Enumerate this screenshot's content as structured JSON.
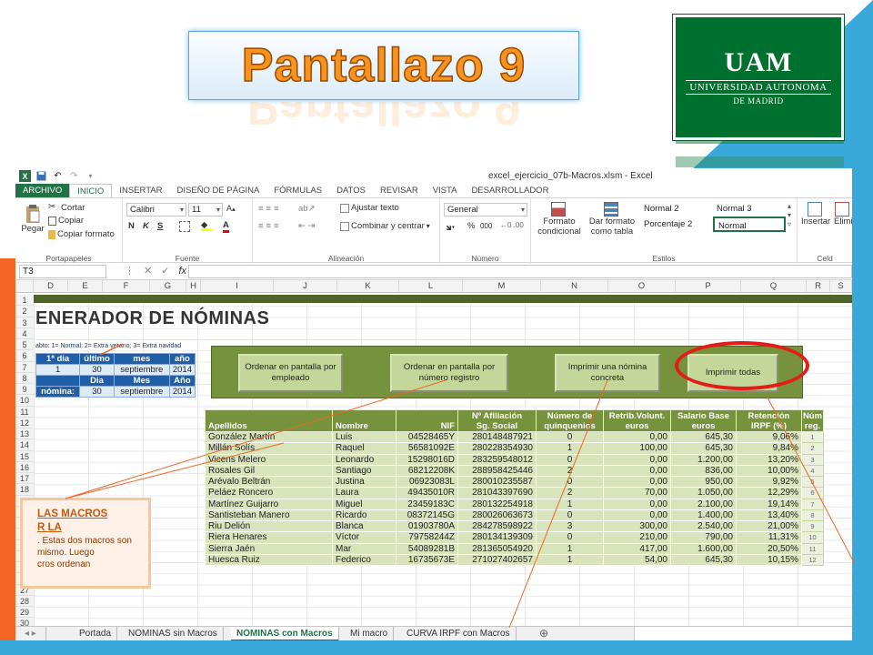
{
  "slide": {
    "title": "Pantallazo 9",
    "logo": {
      "mark": "UAM",
      "line1": "UNIVERSIDAD AUTONOMA",
      "line2": "DE MADRID"
    }
  },
  "window": {
    "title": "excel_ejercicio_07b-Macros.xlsm - Excel"
  },
  "tabs": [
    {
      "label": "ARCHIVO"
    },
    {
      "label": "INICIO"
    },
    {
      "label": "INSERTAR"
    },
    {
      "label": "DISEÑO DE PÁGINA"
    },
    {
      "label": "FÓRMULAS"
    },
    {
      "label": "DATOS"
    },
    {
      "label": "REVISAR"
    },
    {
      "label": "VISTA"
    },
    {
      "label": "DESARROLLADOR"
    }
  ],
  "ribbon": {
    "clipboard": {
      "paste": "Pegar",
      "cut": "Cortar",
      "copy": "Copiar",
      "format_painter": "Copiar formato",
      "label": "Portapapeles"
    },
    "font": {
      "name": "Calibri",
      "size": "11",
      "bold": "N",
      "italic": "K",
      "underline": "S",
      "label": "Fuente"
    },
    "alignment": {
      "wrap": "Ajustar texto",
      "merge": "Combinar y centrar",
      "label": "Alineación"
    },
    "number": {
      "format": "General",
      "percent": "%",
      "thousands": "000",
      "label": "Número"
    },
    "styles": {
      "conditional": "Formato condicional",
      "table": "Dar formato como tabla",
      "normal2": "Normal 2",
      "normal3": "Normal 3",
      "percent2": "Porcentaje 2",
      "normal": "Normal",
      "label": "Estilos"
    },
    "cells": {
      "insert": "Insertar",
      "delete": "Elimi",
      "label": "Celd"
    }
  },
  "formula_bar": {
    "name_box": "T3",
    "fx": "fx",
    "value": ""
  },
  "columns": [
    "D",
    "E",
    "F",
    "G",
    "H",
    "I",
    "J",
    "K",
    "L",
    "M",
    "N",
    "O",
    "P",
    "Q",
    "R",
    "S"
  ],
  "rows": [
    "1",
    "2",
    "3",
    "4",
    "5",
    "6",
    "7",
    "8",
    "9",
    "10",
    "11",
    "12",
    "13",
    "14",
    "15",
    "16",
    "17",
    "18",
    "19",
    "20",
    "21",
    "22",
    "23",
    "24",
    "25",
    "26",
    "27",
    "28",
    "29",
    "30"
  ],
  "sheet": {
    "heading": "ENERADOR DE NÓMINAS",
    "note": "abto: 1= Normal; 2= Extra verano; 3= Extra navidad",
    "date_box": {
      "header1": [
        "1ª dia",
        "último",
        "mes",
        "año"
      ],
      "row1": [
        "1",
        "30",
        "septiembre",
        "2014"
      ],
      "header2": [
        "",
        "Dia",
        "Mes",
        "Año"
      ],
      "row2": [
        "nómina:",
        "30",
        "septiembre",
        "2014"
      ]
    },
    "buttons": [
      {
        "label": "Ordenar en pantalla por empleado"
      },
      {
        "label": "Ordenar en pantalla por número registro"
      },
      {
        "label": "Imprimir una nómina concreta"
      },
      {
        "label": "Imprimir todas"
      }
    ],
    "table": {
      "group_headers": [
        "Nº Afiliación",
        "Número de",
        "Retrib.Volunt.",
        "Salario Base",
        "Retención",
        "Núm"
      ],
      "headers": [
        "Apellidos",
        "Nombre",
        "NIF",
        "Sg. Social",
        "quinquenios",
        "euros",
        "euros",
        "IRPF (%)",
        "reg."
      ],
      "rows": [
        [
          "González Martín",
          "Luis",
          "04528465Y",
          "280148487921",
          "0",
          "0,00",
          "645,30",
          "9,06%",
          "1"
        ],
        [
          "Millán Solís",
          "Raquel",
          "56581092E",
          "280228354930",
          "1",
          "100,00",
          "645,30",
          "9,84%",
          "2"
        ],
        [
          "Vicens Melero",
          "Leonardo",
          "15298016D",
          "283259548012",
          "0",
          "0,00",
          "1.200,00",
          "13,20%",
          "3"
        ],
        [
          "Rosales Gil",
          "Santiago",
          "68212208K",
          "288958425446",
          "2",
          "0,00",
          "836,00",
          "10,00%",
          "4"
        ],
        [
          "Arévalo Beltrán",
          "Justina",
          "06923083L",
          "280010235587",
          "0",
          "0,00",
          "950,00",
          "9,92%",
          "5"
        ],
        [
          "Peláez Roncero",
          "Laura",
          "49435010R",
          "281043397690",
          "2",
          "70,00",
          "1.050,00",
          "12,29%",
          "6"
        ],
        [
          "Martínez Guijarro",
          "Miguel",
          "23459183C",
          "280132254918",
          "1",
          "0,00",
          "2.100,00",
          "19,14%",
          "7"
        ],
        [
          "Santisteban Manero",
          "Ricardo",
          "08372145G",
          "280026063673",
          "0",
          "0,00",
          "1.400,00",
          "13,40%",
          "8"
        ],
        [
          "Riu Delión",
          "Blanca",
          "01903780A",
          "284278598922",
          "3",
          "300,00",
          "2.540,00",
          "21,00%",
          "9"
        ],
        [
          "Riera Henares",
          "Víctor",
          "79758244Z",
          "280134139309",
          "0",
          "210,00",
          "790,00",
          "11,31%",
          "10"
        ],
        [
          "Sierra Jaén",
          "Mar",
          "54089281B",
          "281365054920",
          "1",
          "417,00",
          "1.600,00",
          "20,50%",
          "11"
        ],
        [
          "Huesca Ruiz",
          "Federico",
          "16735673E",
          "271027402657",
          "1",
          "54,00",
          "645,30",
          "10,15%",
          "12"
        ]
      ]
    },
    "callout": {
      "line1": "LAS MACROS",
      "line2": "R LA",
      "line3": ". Estas dos macros son",
      "line4": "mismo. Luego",
      "line5": "cros ordenan"
    }
  },
  "sheet_tabs": [
    {
      "label": "Portada"
    },
    {
      "label": "NOMINAS sin Macros"
    },
    {
      "label": "NOMINAS con Macros"
    },
    {
      "label": "Mi macro"
    },
    {
      "label": "CURVA IRPF con Macros"
    }
  ],
  "colors": {
    "accent_orange": "#f26522",
    "accent_blue": "#39a9dc",
    "excel_green": "#217346",
    "highlight_red": "#e41b17"
  }
}
